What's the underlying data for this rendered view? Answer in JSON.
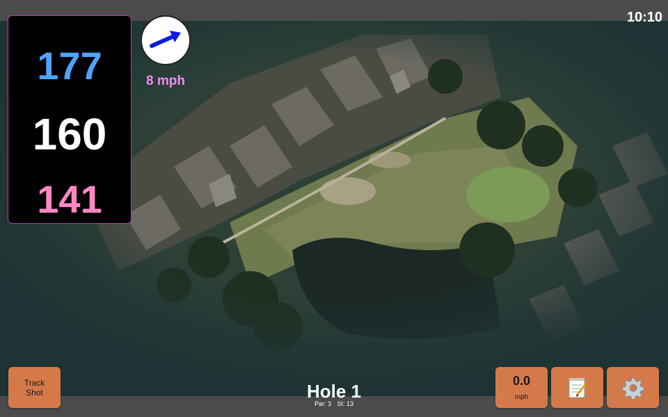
{
  "status": {
    "time": "10:10"
  },
  "yardages": {
    "back": "177",
    "middle": "160",
    "front": "141"
  },
  "wind": {
    "speed_label": "8 mph",
    "icon": "wind-direction-arrow-icon"
  },
  "hole": {
    "title": "Hole 1",
    "par_label": "Par: 3",
    "si_label": "SI: 13"
  },
  "buttons": {
    "track_shot_line1": "Track",
    "track_shot_line2": "Shot",
    "speed_value": "0.0",
    "speed_unit": "mph",
    "notes_icon": "notepad-icon",
    "settings_icon": "gear-icon"
  },
  "colors": {
    "accent_button": "#d47a4a",
    "back_yardage": "#4ea3ff",
    "middle_yardage": "#ffffff",
    "front_yardage": "#ff88c4",
    "wind_label": "#f08cf0"
  }
}
